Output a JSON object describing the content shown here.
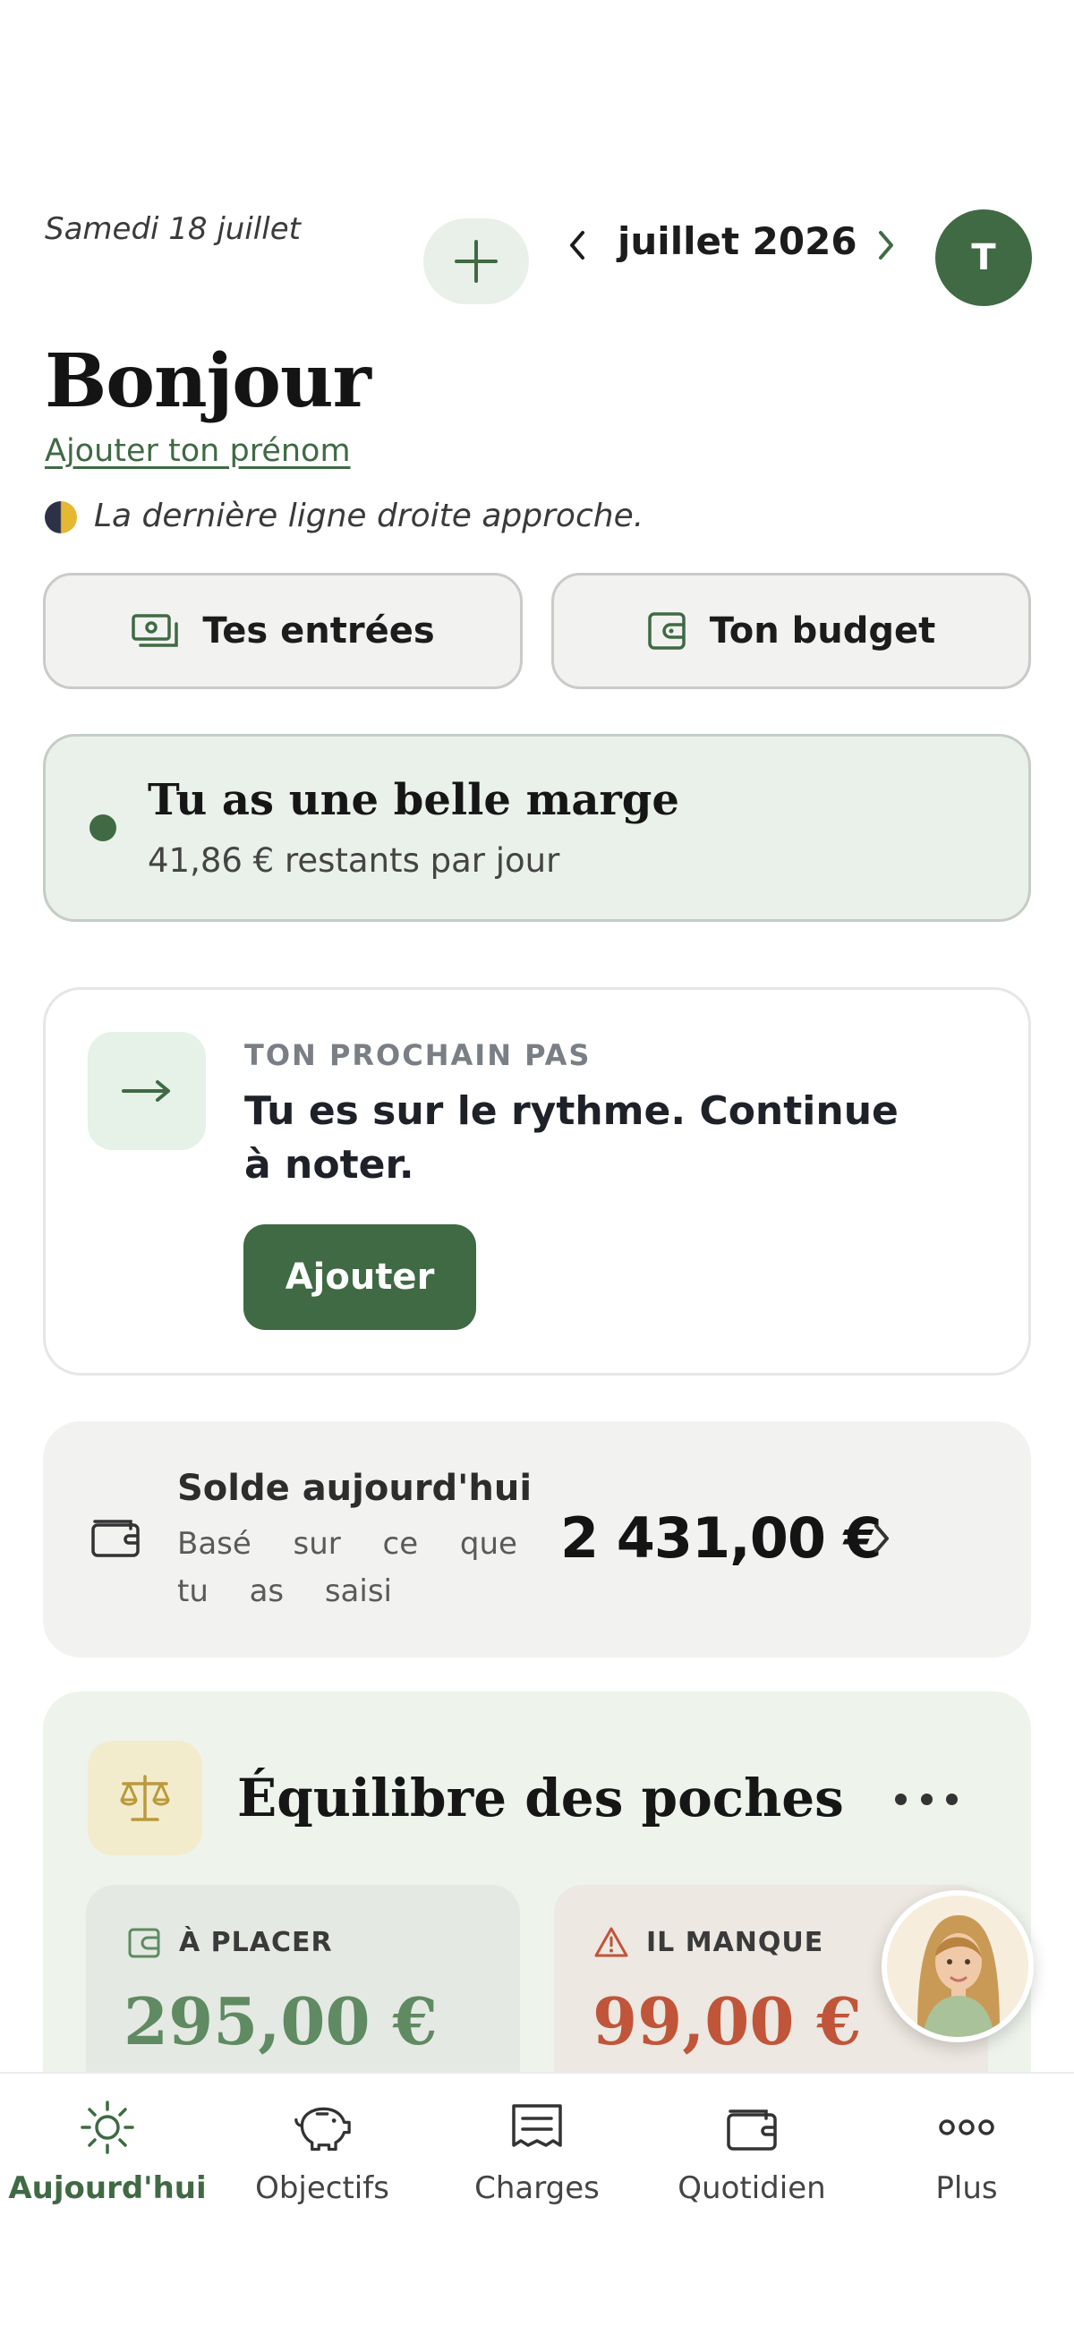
{
  "header": {
    "date": "Samedi 18 juillet",
    "month": "juillet 2026",
    "avatar_initial": "T"
  },
  "greeting": {
    "title": "Bonjour",
    "name_link": "Ajouter ton prénom",
    "tagline": "La dernière ligne droite approche."
  },
  "actions": {
    "entries": "Tes entrées",
    "budget": "Ton budget"
  },
  "margin": {
    "title": "Tu as une belle marge",
    "subtitle": "41,86 € restants par jour"
  },
  "next_step": {
    "eyebrow": "TON PROCHAIN PAS",
    "text": "Tu es sur le rythme. Continue à noter.",
    "button": "Ajouter"
  },
  "balance": {
    "title": "Solde aujourd'hui",
    "subtitle_words_line1": [
      "Basé",
      "sur",
      "ce",
      "que"
    ],
    "subtitle_words_line2": [
      "tu",
      "as",
      "saisi"
    ],
    "amount": "2 431,00 €"
  },
  "poches": {
    "title": "Équilibre des poches",
    "to_place_label": "À PLACER",
    "to_place_amount": "295,00 €",
    "missing_label": "IL MANQUE",
    "missing_amount": "99,00 €"
  },
  "nav": {
    "items": [
      {
        "label": "Aujourd'hui",
        "icon": "sun-icon",
        "active": true
      },
      {
        "label": "Objectifs",
        "icon": "piggy-bank-icon",
        "active": false
      },
      {
        "label": "Charges",
        "icon": "receipt-icon",
        "active": false
      },
      {
        "label": "Quotidien",
        "icon": "wallet-icon",
        "active": false
      },
      {
        "label": "Plus",
        "icon": "more-dots-icon",
        "active": false
      }
    ]
  },
  "colors": {
    "accent": "#3f6a44",
    "accent_soft": "#eaf0ea",
    "positive": "#5f8a62",
    "warning": "#c0553a",
    "gold": "#b99a3c"
  }
}
